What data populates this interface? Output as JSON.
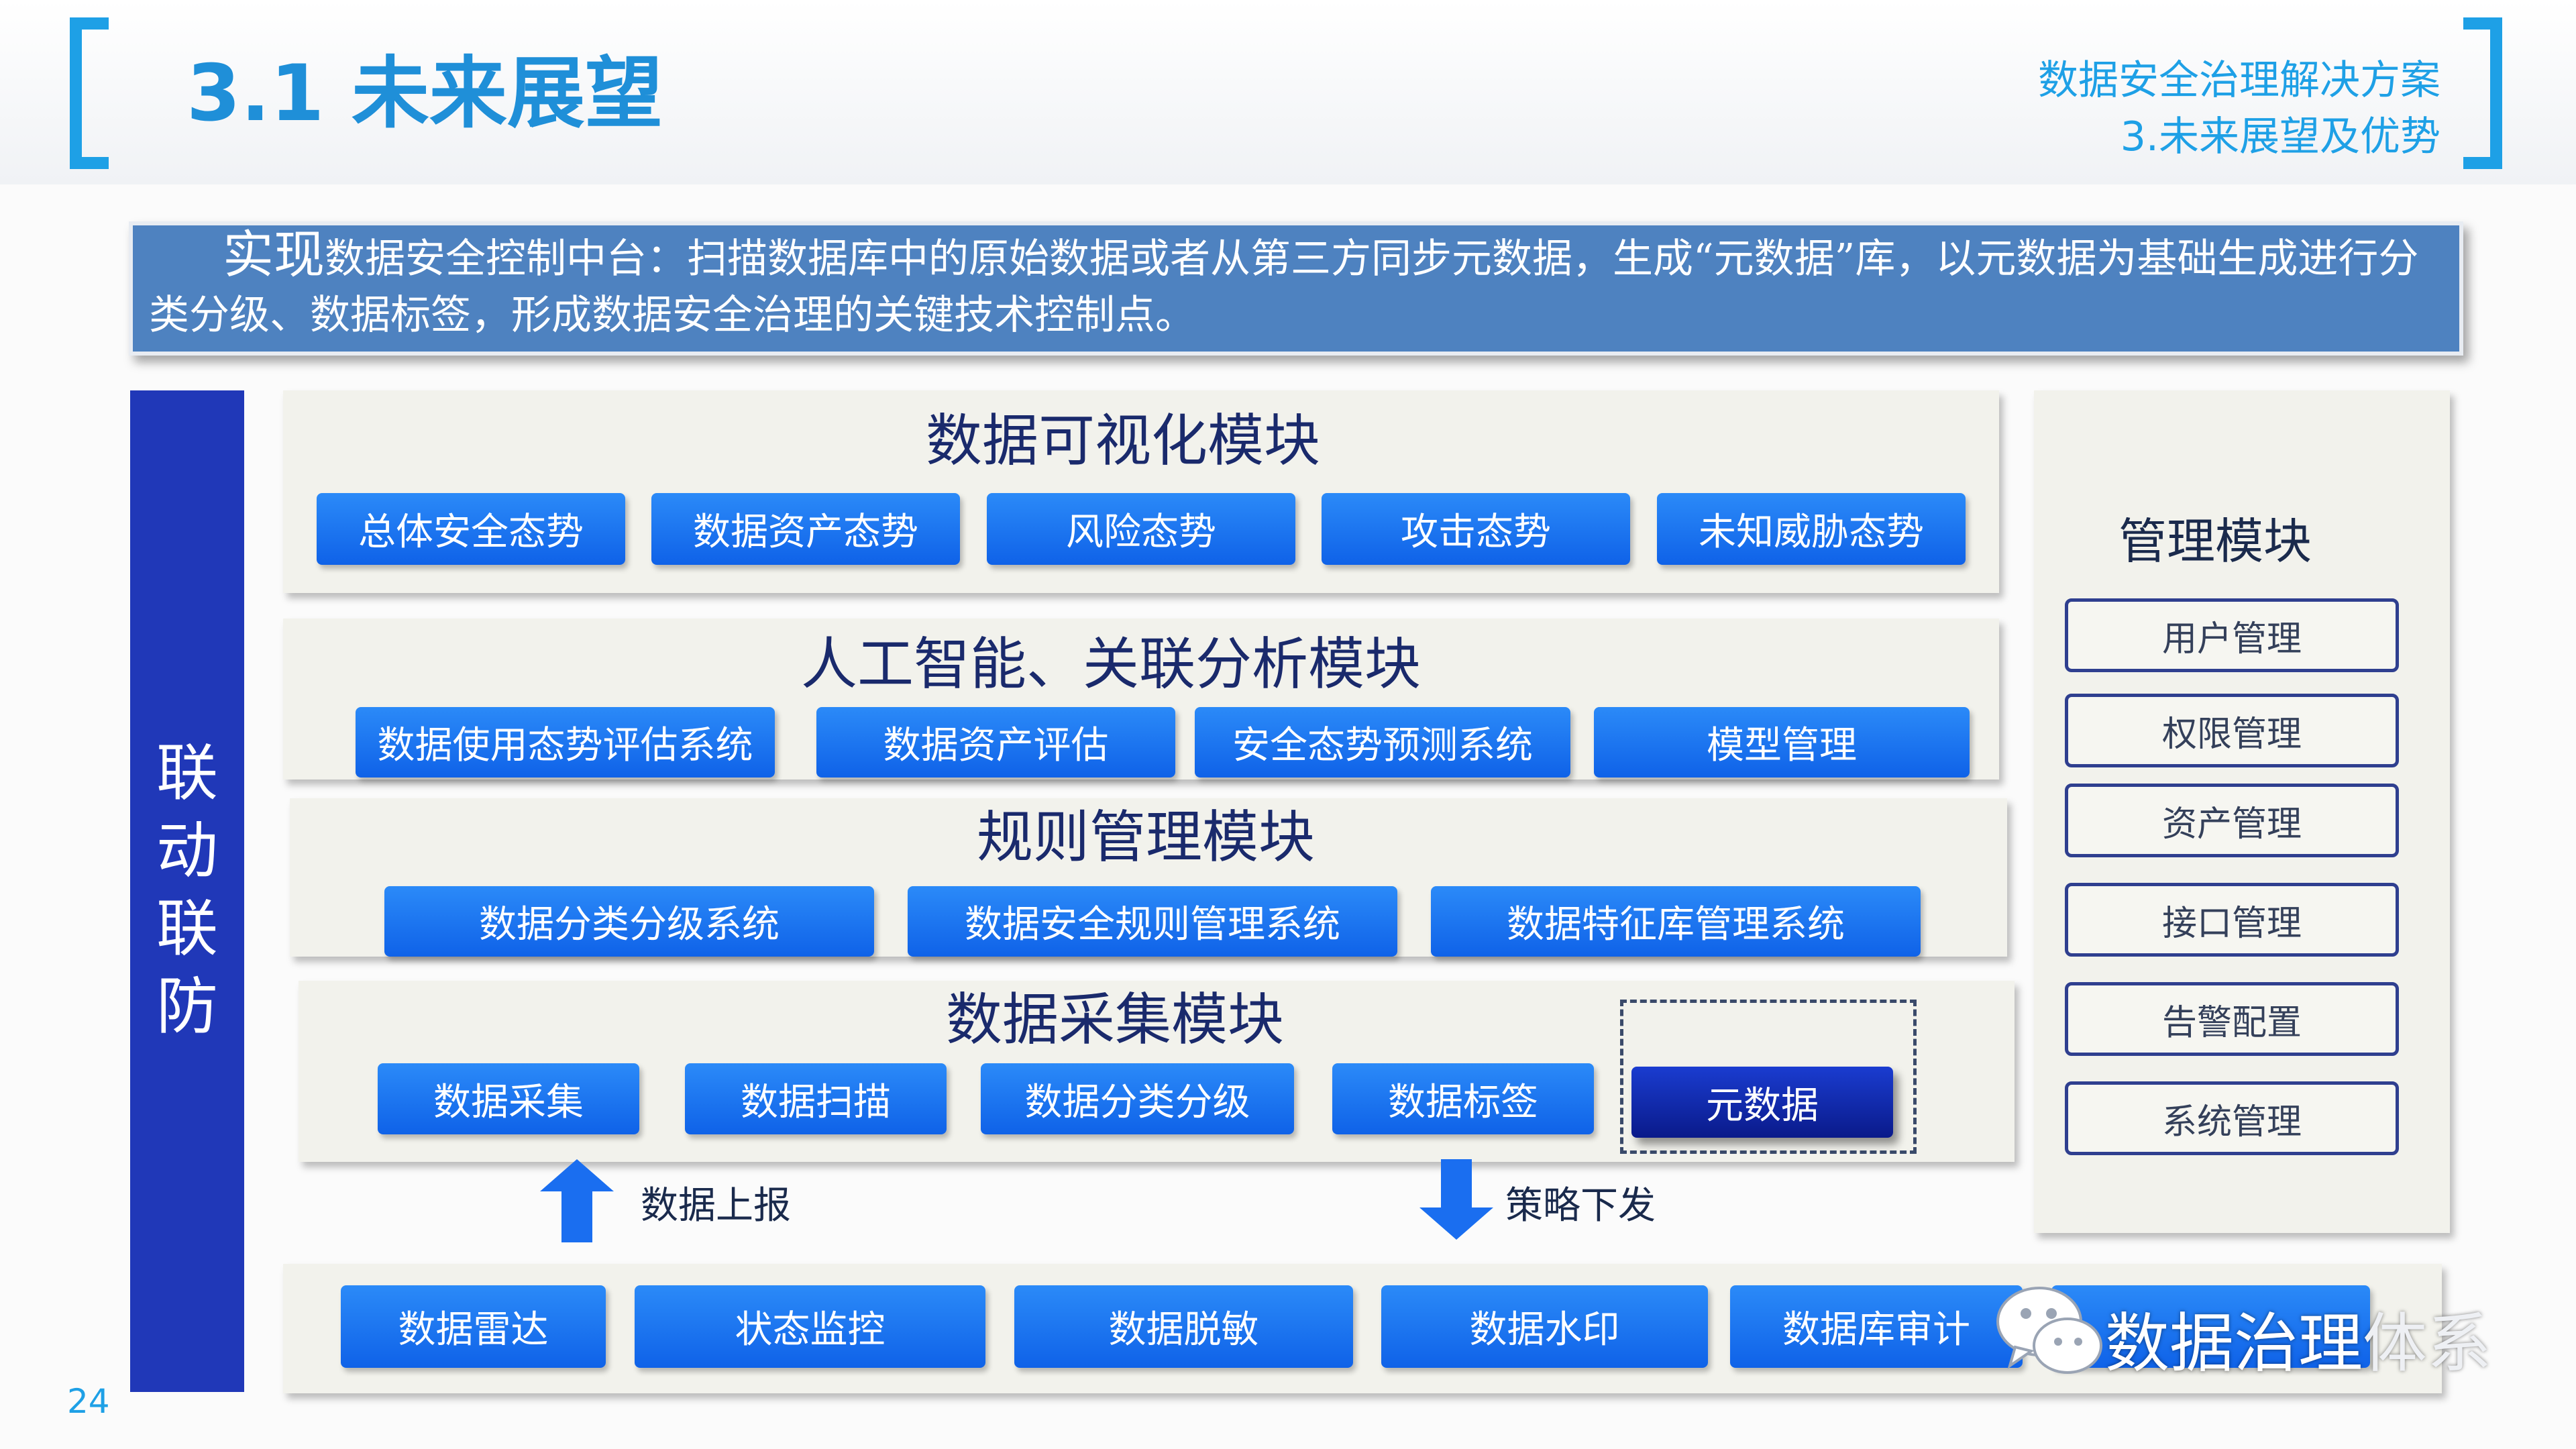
{
  "header": {
    "title": "3.1 未来展望",
    "subtitle_line1": "数据安全治理解决方案",
    "subtitle_line2": "3.未来展望及优势"
  },
  "intro": {
    "lead": "实现",
    "text": "数据安全控制中台：扫描数据库中的原始数据或者从第三方同步元数据，生成“元数据”库，以元数据为基础生成进行分类分级、数据标签，形成数据安全治理的关键技术控制点。"
  },
  "linkage": {
    "label": "联动联防"
  },
  "visualization": {
    "title": "数据可视化模块",
    "items": [
      "总体安全态势",
      "数据资产态势",
      "风险态势",
      "攻击态势",
      "未知威胁态势"
    ]
  },
  "ai": {
    "title": "人工智能、关联分析模块",
    "items": [
      "数据使用态势评估系统",
      "数据资产评估",
      "安全态势预测系统",
      "模型管理"
    ]
  },
  "rules": {
    "title": "规则管理模块",
    "items": [
      "数据分类分级系统",
      "数据安全规则管理系统",
      "数据特征库管理系统"
    ]
  },
  "collection": {
    "title": "数据采集模块",
    "items": [
      "数据采集",
      "数据扫描",
      "数据分类分级",
      "数据标签"
    ],
    "metadata": "元数据"
  },
  "arrows": {
    "up_label": "数据上报",
    "down_label": "策略下发"
  },
  "bottom": {
    "items": [
      "数据雷达",
      "状态监控",
      "数据脱敏",
      "数据水印",
      "数据库审计",
      ""
    ]
  },
  "management": {
    "title": "管理模块",
    "items": [
      "用户管理",
      "权限管理",
      "资产管理",
      "接口管理",
      "告警配置",
      "系统管理"
    ]
  },
  "watermark": {
    "text_bold": "数据治理",
    "text_light": "体系"
  },
  "page_number": "24",
  "colors": {
    "accent": "#1ea0e6",
    "button": "#1a6ef0",
    "dark_button": "#0e22a8",
    "linkage": "#2038b8",
    "intro": "#4e82c0"
  }
}
